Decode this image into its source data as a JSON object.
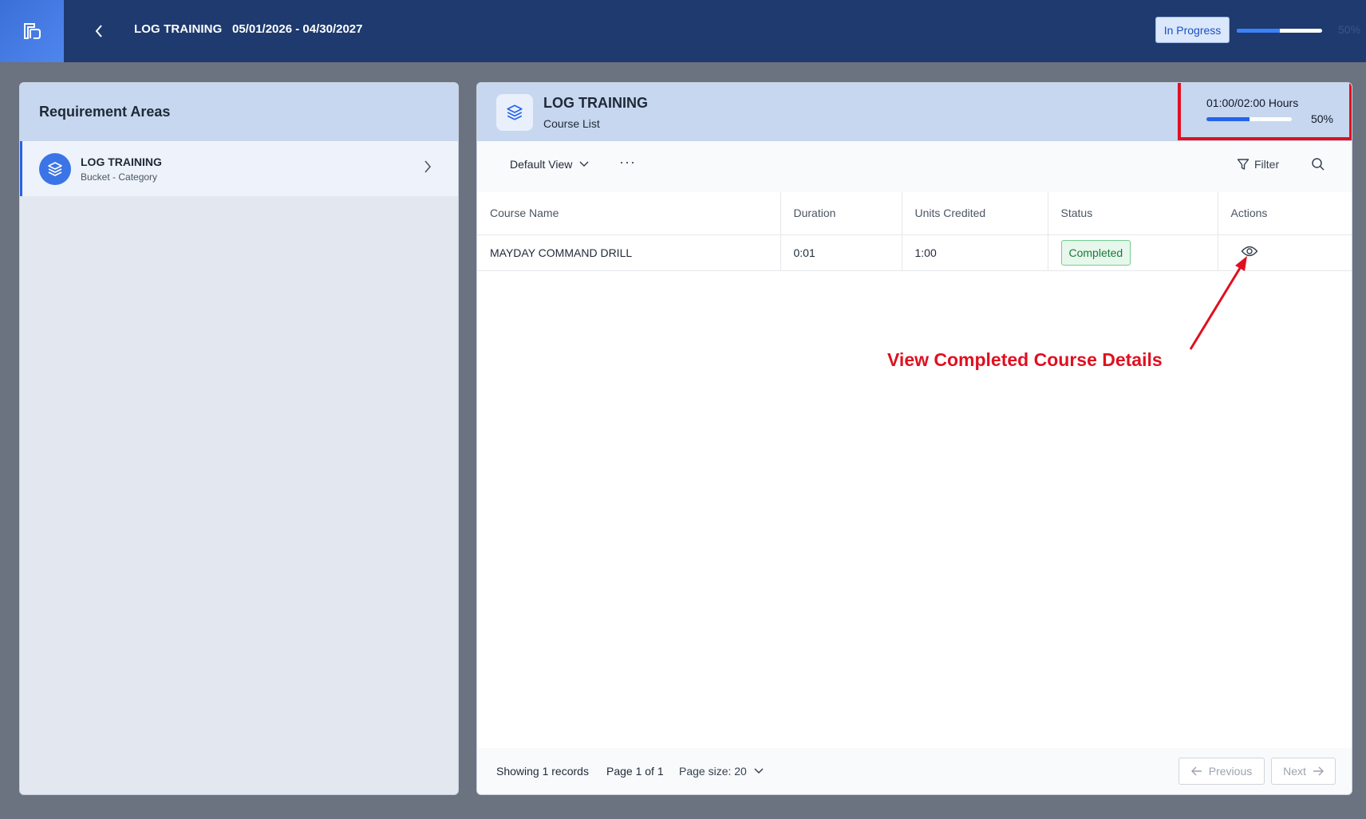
{
  "topbar": {
    "title": "LOG TRAINING",
    "date_range": "05/01/2026 - 04/30/2027",
    "status": "In Progress",
    "progress_fraction": 0.5,
    "progress_label": "50%"
  },
  "left_panel": {
    "title": "Requirement Areas",
    "items": [
      {
        "title": "LOG TRAINING",
        "subtitle": "Bucket - Category"
      }
    ]
  },
  "right_panel": {
    "title": "LOG TRAINING",
    "subtitle": "Course List",
    "hours_label": "01:00/02:00 Hours",
    "hours_fraction": 0.5,
    "hours_pct": "50%",
    "toolbar": {
      "view_label": "Default View",
      "more_label": "···",
      "filter_label": "Filter"
    },
    "table": {
      "headers": [
        "Course Name",
        "Duration",
        "Units Credited",
        "Status",
        "Actions"
      ],
      "rows": [
        {
          "course_name": "MAYDAY COMMAND DRILL",
          "duration": "0:01",
          "units_credited": "1:00",
          "status": "Completed"
        }
      ]
    },
    "annotation": "View Completed Course Details",
    "footer": {
      "showing": "Showing 1 records",
      "page": "Page 1 of 1",
      "page_size": "Page size: 20",
      "previous_label": "Previous",
      "next_label": "Next"
    }
  },
  "colors": {
    "topbar_bg": "#1e3a6e",
    "accent": "#2563eb",
    "annotation": "#e01020",
    "success": "#1b7a3a"
  },
  "icons": [
    "app-logo-icon",
    "chevron-left-icon",
    "layers-icon",
    "chevron-right-icon",
    "chevron-down-icon",
    "filter-icon",
    "search-icon",
    "eye-icon",
    "arrow-left-icon",
    "arrow-right-icon"
  ]
}
